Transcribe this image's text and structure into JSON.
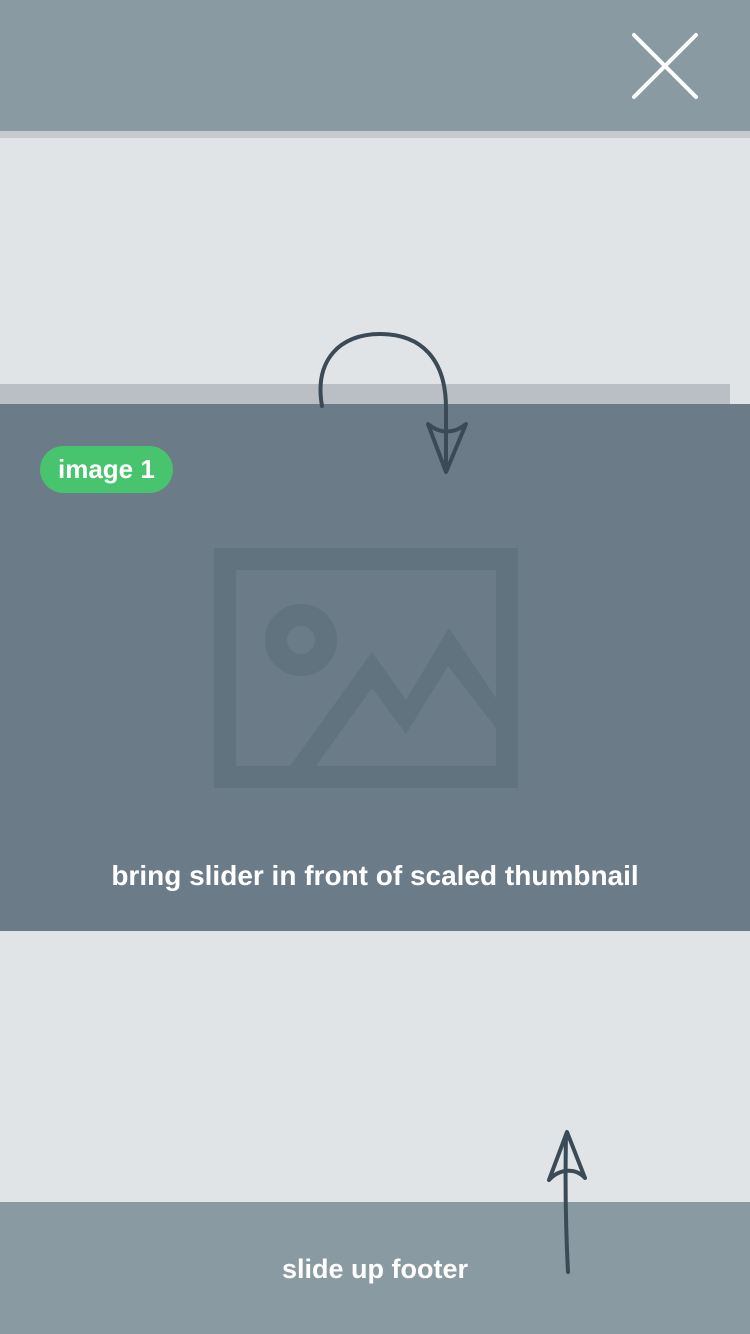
{
  "colors": {
    "background": "#e1e4e7",
    "header": "#8a9aa3",
    "slider": "#6b7b87",
    "badge": "#48c36e",
    "annotation": "#3a4a56"
  },
  "header": {
    "close_icon": "close-icon"
  },
  "slider": {
    "badge_label": "image 1",
    "placeholder_icon": "image-placeholder-icon",
    "caption": "bring slider in front of scaled thumbnail"
  },
  "footer": {
    "label": "slide up footer"
  }
}
